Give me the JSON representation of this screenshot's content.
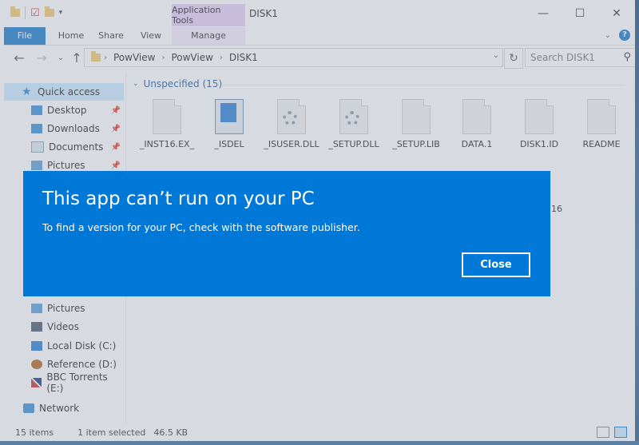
{
  "window": {
    "title": "DISK1",
    "context_tab": "Application Tools",
    "minimize": "—",
    "maximize": "☐",
    "close": "✕"
  },
  "ribbon": {
    "tabs": [
      "File",
      "Home",
      "Share",
      "View",
      "Manage"
    ]
  },
  "address": {
    "breadcrumbs": [
      "PowView",
      "PowView",
      "DISK1"
    ],
    "search_placeholder": "Search DISK1"
  },
  "nav": {
    "items": [
      {
        "label": "Quick access",
        "pinned": false
      },
      {
        "label": "Desktop",
        "pinned": true
      },
      {
        "label": "Downloads",
        "pinned": true
      },
      {
        "label": "Documents",
        "pinned": true
      },
      {
        "label": "Pictures",
        "pinned": true
      }
    ],
    "lower_items": [
      {
        "label": "Pictures"
      },
      {
        "label": "Videos"
      },
      {
        "label": "Local Disk (C:)"
      },
      {
        "label": "Reference (D:)"
      },
      {
        "label": "BBC Torrents (E:)"
      },
      {
        "label": "Network"
      }
    ]
  },
  "content": {
    "group_header": "Unspecified (15)",
    "files": [
      {
        "name": "_INST16.EX_",
        "icon": "doc-icon"
      },
      {
        "name": "_ISDEL",
        "icon": "app-icon"
      },
      {
        "name": "_ISUSER.DLL",
        "icon": "gear-doc-icon"
      },
      {
        "name": "_SETUP.DLL",
        "icon": "gear-doc-icon"
      },
      {
        "name": "_SETUP.LIB",
        "icon": "doc-icon"
      },
      {
        "name": "DATA.1",
        "icon": "doc-icon"
      },
      {
        "name": "DISK1.ID",
        "icon": "doc-icon"
      },
      {
        "name": "README",
        "icon": "text-doc-icon"
      }
    ],
    "partial_label": "16"
  },
  "dialog": {
    "title": "This app can’t run on your PC",
    "message": "To find a version for your PC, check with the software publisher.",
    "close_label": "Close",
    "color": "#0078d7"
  },
  "status": {
    "item_count": "15 items",
    "selection": "1 item selected",
    "size": "46.5 KB"
  }
}
